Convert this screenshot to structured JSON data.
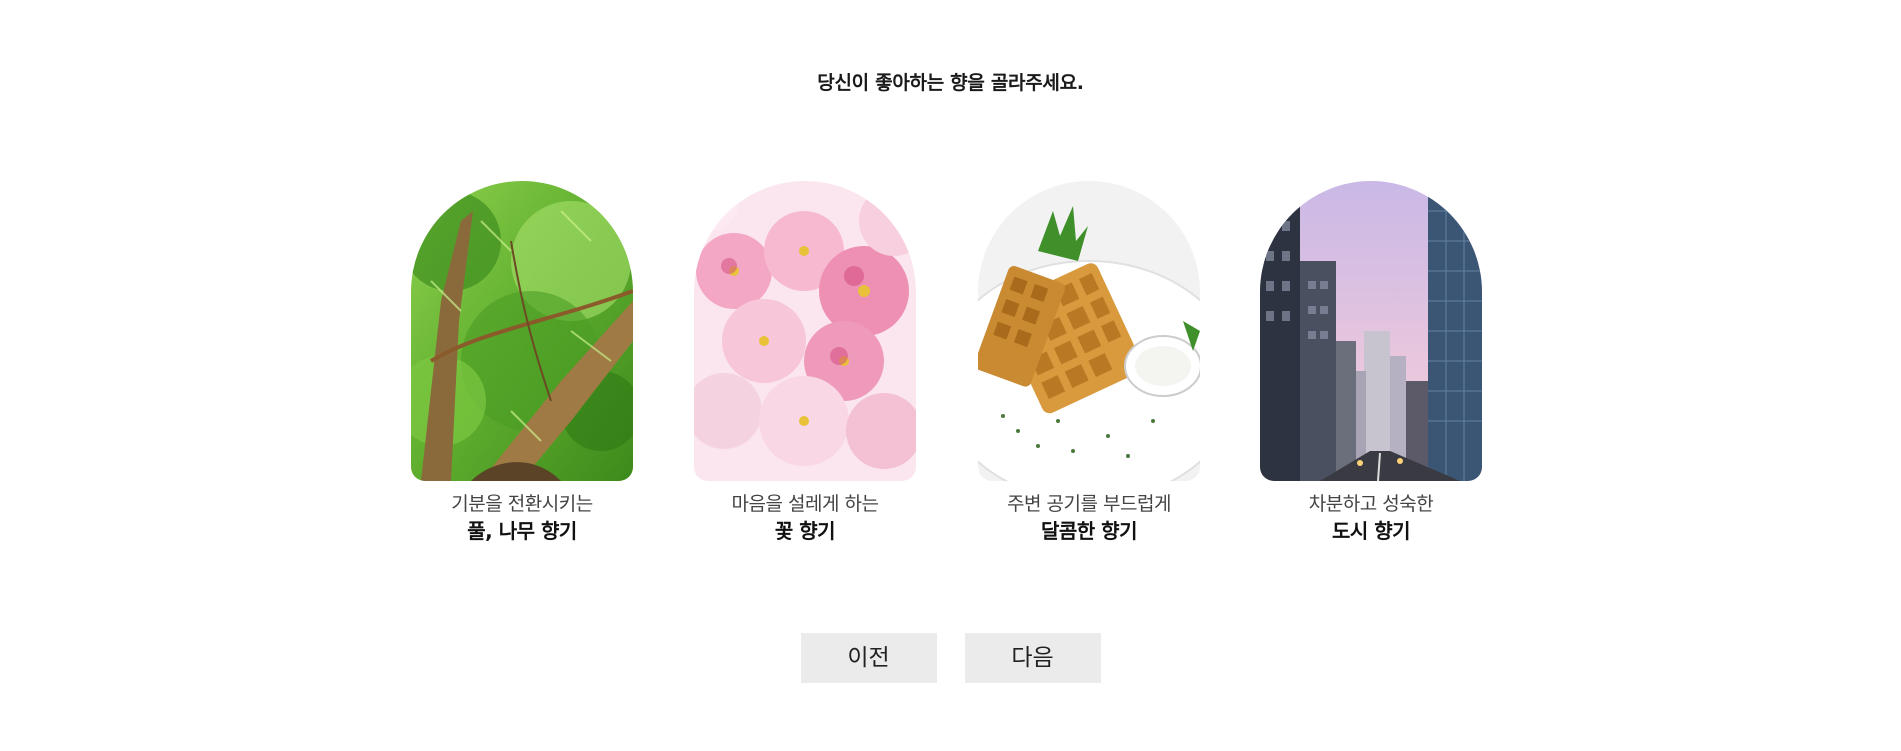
{
  "title": "당신이 좋아하는 향을 골라주세요.",
  "options": [
    {
      "subtitle": "기분을 전환시키는",
      "label": "풀, 나무 향기",
      "image": "tree-leaves-photo"
    },
    {
      "subtitle": "마음을 설레게 하는",
      "label": "꽃 향기",
      "image": "pink-blossoms-photo"
    },
    {
      "subtitle": "주변 공기를 부드럽게",
      "label": "달콤한 향기",
      "image": "waffle-plate-photo"
    },
    {
      "subtitle": "차분하고 성숙한",
      "label": "도시 향기",
      "image": "city-street-photo"
    }
  ],
  "buttons": {
    "prev_label": "이전",
    "next_label": "다음"
  },
  "colors": {
    "button_bg": "#ebebeb",
    "text": "#222222"
  }
}
